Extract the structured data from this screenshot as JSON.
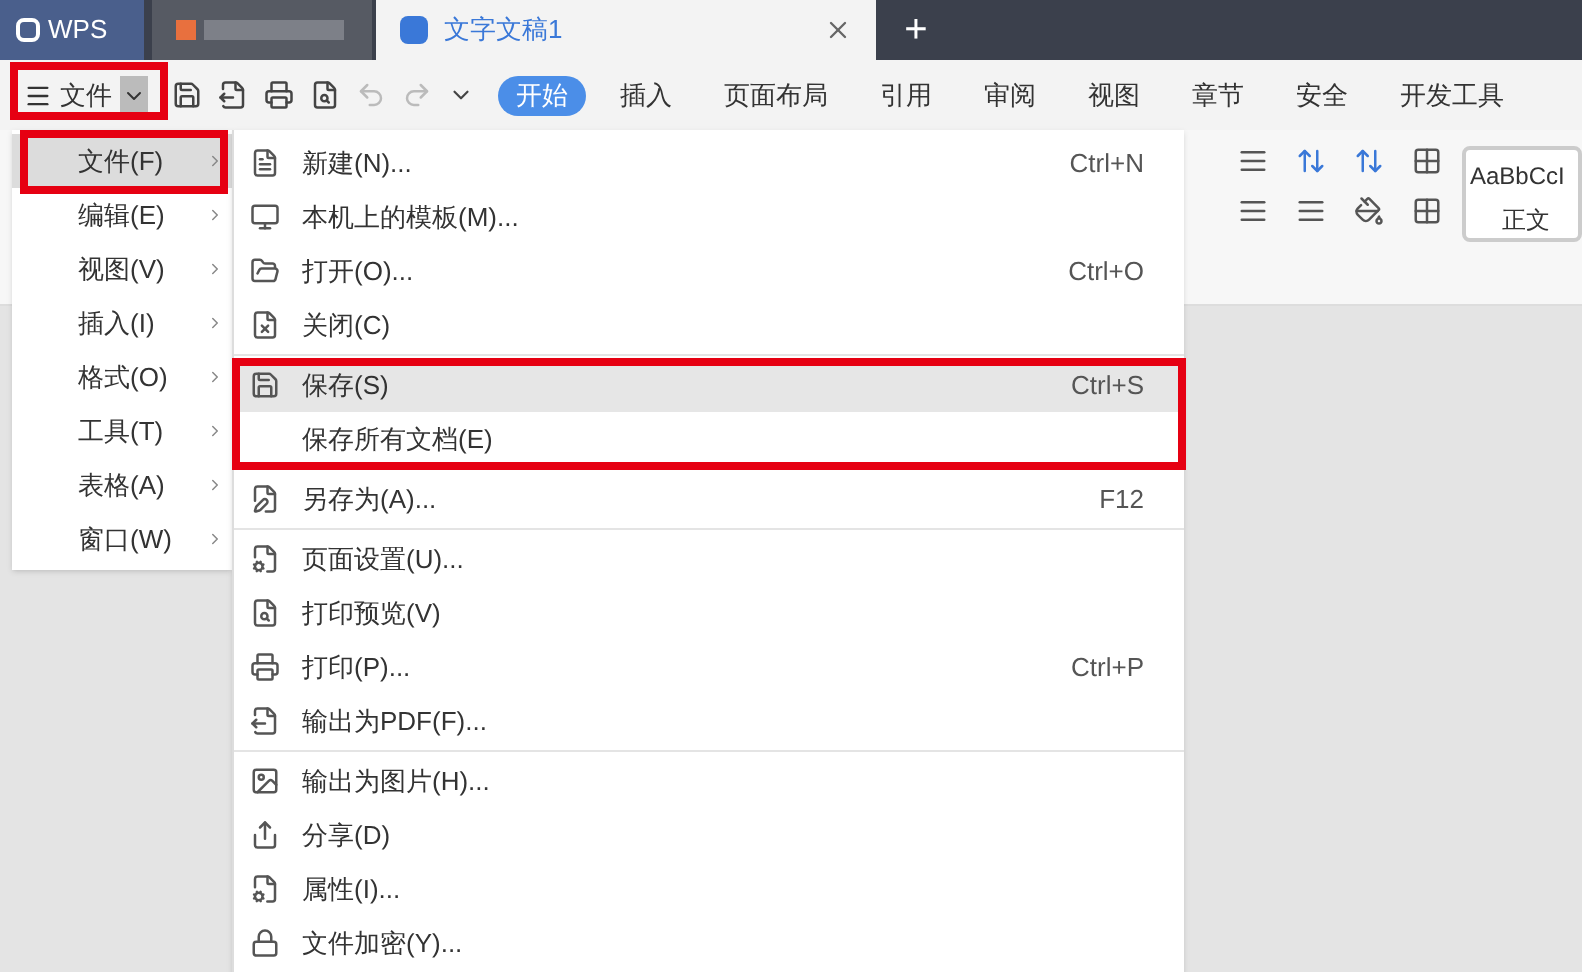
{
  "title_tabs": [
    {
      "label": "WPS",
      "selected": false,
      "kind": "app"
    },
    {
      "selected": false,
      "kind": "blurred"
    },
    {
      "label": "文字文稿1",
      "selected": true,
      "kind": "doc"
    }
  ],
  "new_tab": "+",
  "file_button": "文件",
  "ribbon_tabs": [
    {
      "label": "开始",
      "selected": true
    },
    {
      "label": "插入",
      "selected": false
    },
    {
      "label": "页面布局",
      "selected": false
    },
    {
      "label": "引用",
      "selected": false
    },
    {
      "label": "审阅",
      "selected": false
    },
    {
      "label": "视图",
      "selected": false
    },
    {
      "label": "章节",
      "selected": false
    },
    {
      "label": "安全",
      "selected": false
    },
    {
      "label": "开发工具",
      "selected": false
    }
  ],
  "style_preview": {
    "sample": "AaBbCcI",
    "name": "正文"
  },
  "menu": [
    {
      "label": "文件(F)",
      "selected": true
    },
    {
      "label": "编辑(E)",
      "selected": false
    },
    {
      "label": "视图(V)",
      "selected": false
    },
    {
      "label": "插入(I)",
      "selected": false
    },
    {
      "label": "格式(O)",
      "selected": false
    },
    {
      "label": "工具(T)",
      "selected": false
    },
    {
      "label": "表格(A)",
      "selected": false
    },
    {
      "label": "窗口(W)",
      "selected": false
    }
  ],
  "submenu_groups": [
    [
      {
        "label": "新建(N)...",
        "shortcut": "Ctrl+N",
        "selected": false
      },
      {
        "label": "本机上的模板(M)...",
        "selected": false
      },
      {
        "label": "打开(O)...",
        "shortcut": "Ctrl+O",
        "selected": false
      },
      {
        "label": "关闭(C)",
        "selected": false
      }
    ],
    [
      {
        "label": "保存(S)",
        "shortcut": "Ctrl+S",
        "selected": true
      },
      {
        "label": "保存所有文档(E)",
        "selected": false
      }
    ],
    [
      {
        "label": "另存为(A)...",
        "shortcut": "F12",
        "selected": false
      }
    ],
    [
      {
        "label": "页面设置(U)...",
        "selected": false
      },
      {
        "label": "打印预览(V)",
        "selected": false
      },
      {
        "label": "打印(P)...",
        "shortcut": "Ctrl+P",
        "selected": false
      },
      {
        "label": "输出为PDF(F)...",
        "selected": false
      }
    ],
    [
      {
        "label": "输出为图片(H)...",
        "selected": false
      },
      {
        "label": "分享(D)",
        "selected": false
      },
      {
        "label": "属性(I)...",
        "selected": false
      },
      {
        "label": "文件加密(Y)...",
        "selected": false
      }
    ]
  ]
}
